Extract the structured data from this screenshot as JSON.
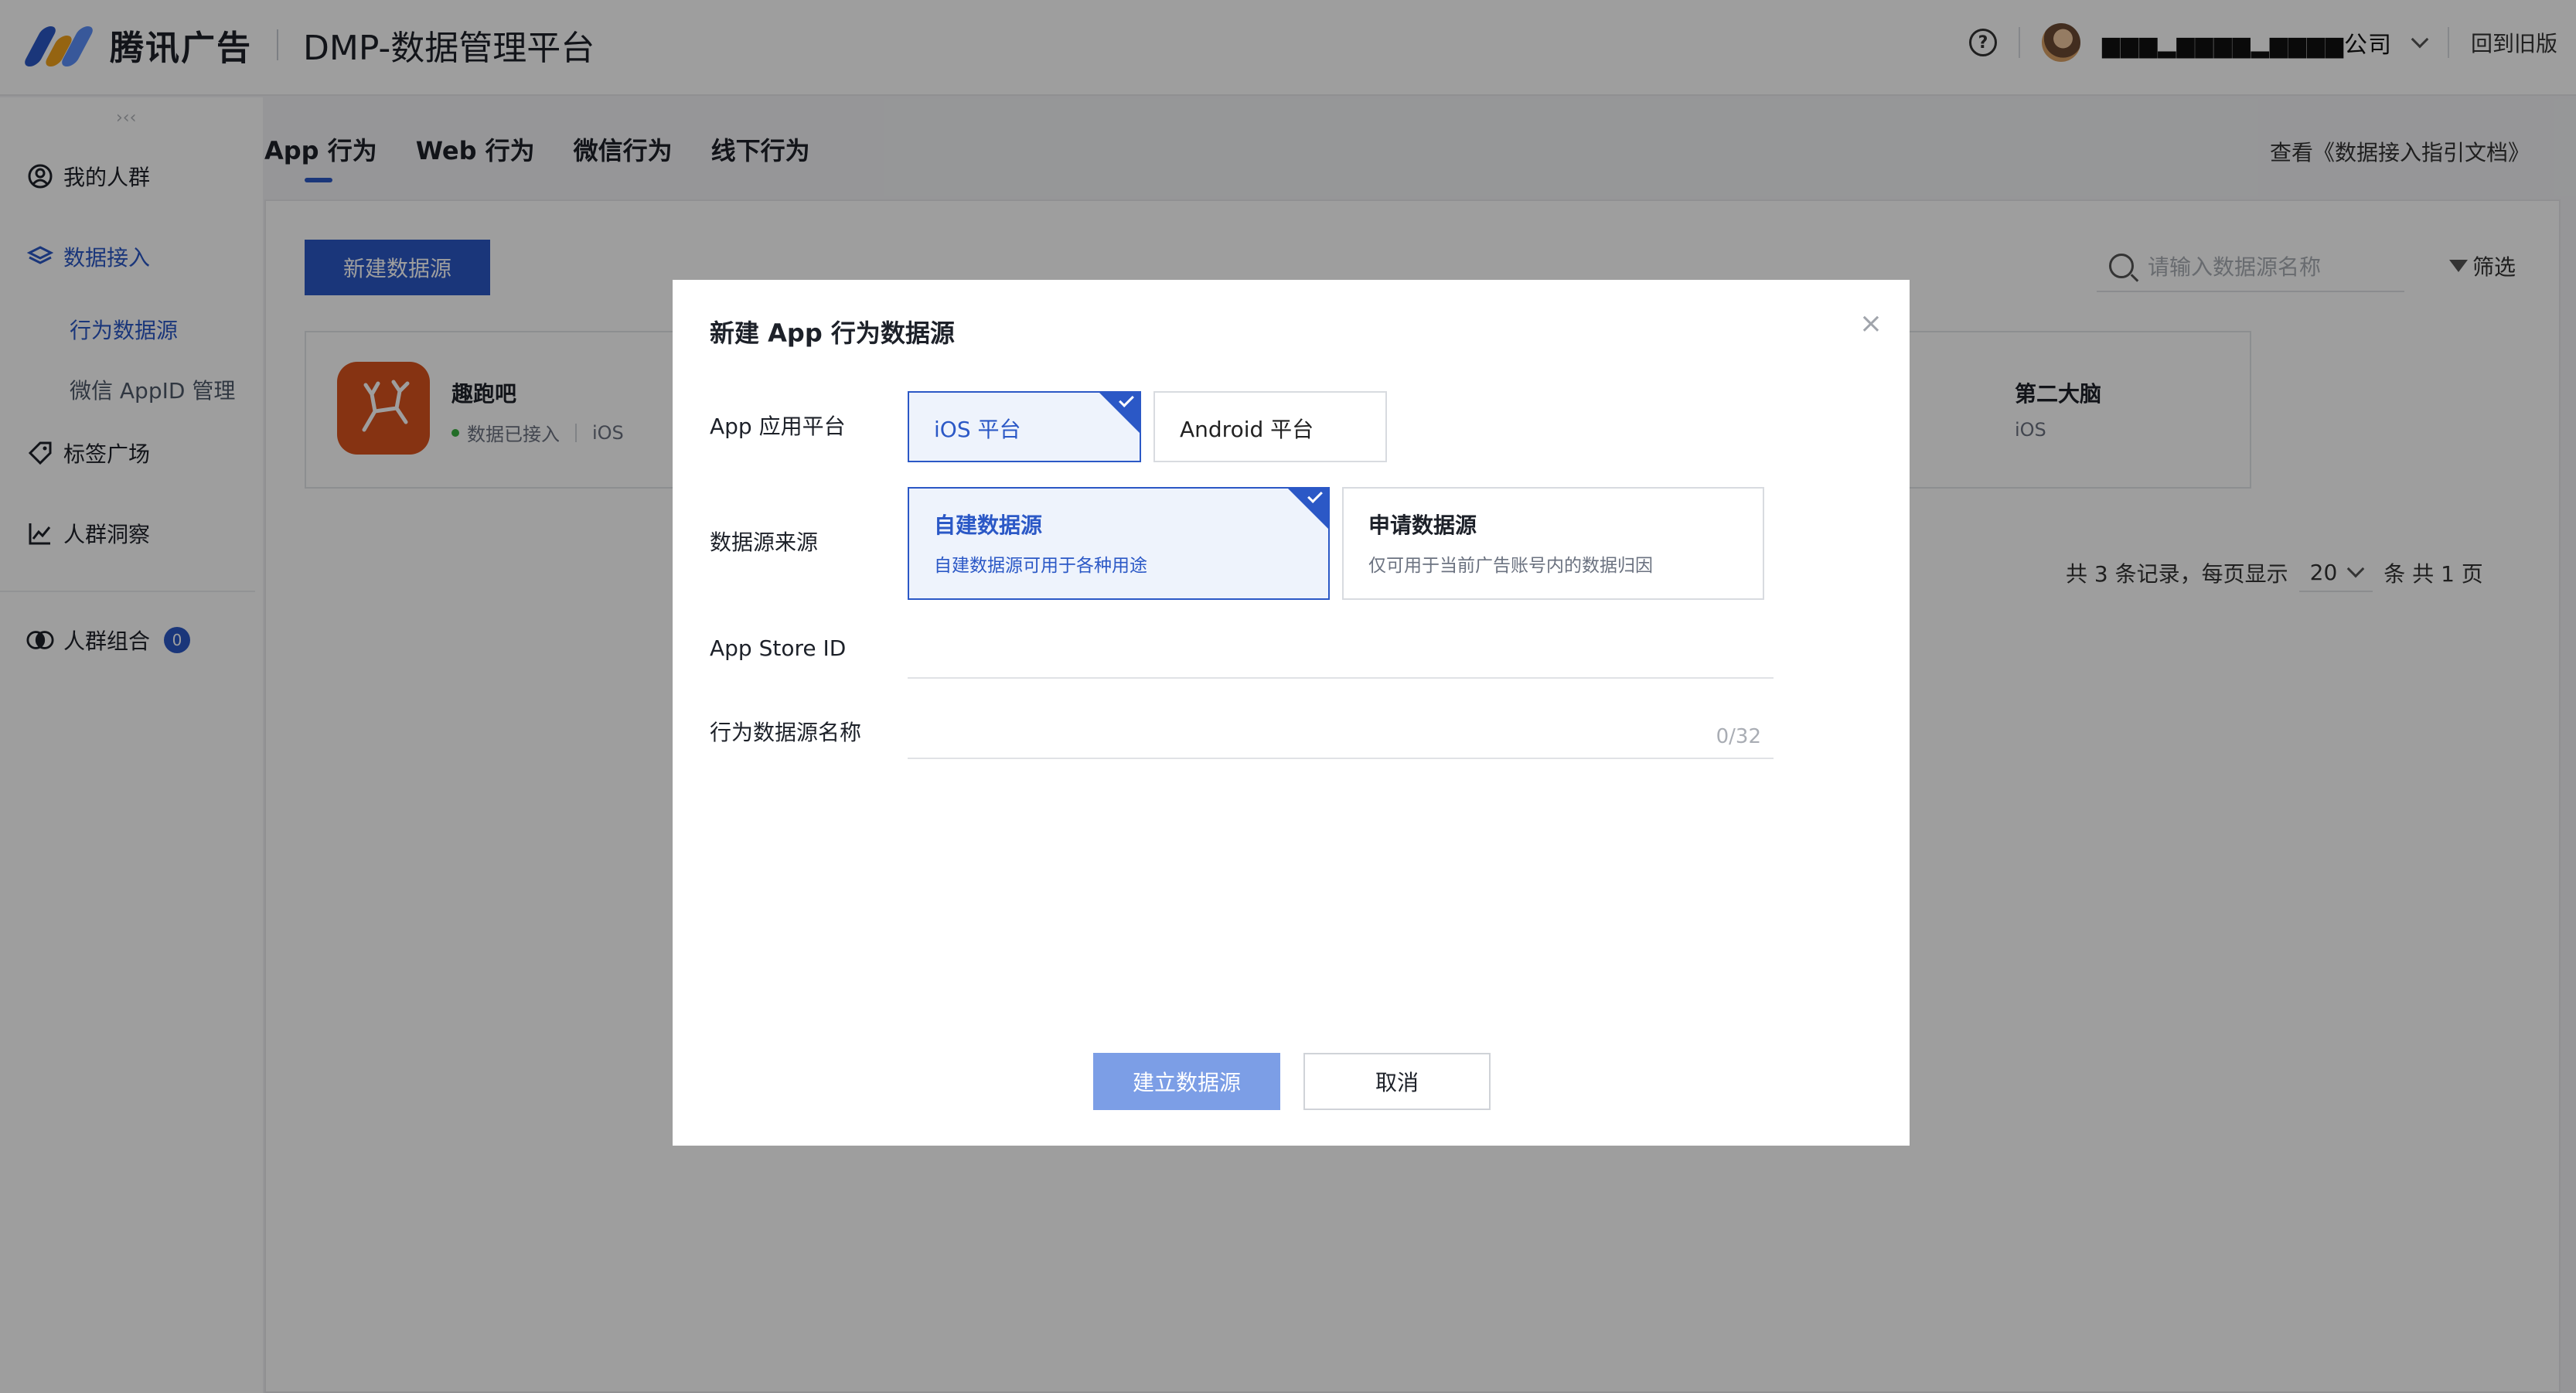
{
  "header": {
    "brand": "腾讯广告",
    "platform": "DMP-数据管理平台",
    "help_icon": "question-circle-icon",
    "account_name": "▆▆▆▂▆▆▆▆▂▆▆▆▆公司",
    "back_to_old": "回到旧版",
    "brand_colors": [
      "#2b58c6",
      "#f0a21c",
      "#5b8ff9"
    ]
  },
  "sidebar": {
    "collapse_glyph": "›‹‹",
    "items": [
      {
        "label": "我的人群",
        "icon": "user-circle-icon"
      },
      {
        "label": "数据接入",
        "icon": "layers-icon",
        "active": true
      },
      {
        "label": "标签广场",
        "icon": "tag-icon"
      },
      {
        "label": "人群洞察",
        "icon": "line-chart-icon"
      },
      {
        "label": "人群组合",
        "icon": "overlap-circles-icon",
        "badge": "0"
      }
    ],
    "subitems": [
      {
        "label": "行为数据源",
        "active": true
      },
      {
        "label": "微信 AppID 管理"
      }
    ]
  },
  "tabs": [
    {
      "label": "App 行为",
      "active": true
    },
    {
      "label": "Web 行为"
    },
    {
      "label": "微信行为"
    },
    {
      "label": "线下行为"
    }
  ],
  "doc_link": "查看《数据接入指引文档》",
  "toolbar": {
    "new_source": "新建数据源",
    "search_placeholder": "请输入数据源名称",
    "filter": "筛选"
  },
  "cards": [
    {
      "name": "趣跑吧",
      "status": "数据已接入",
      "platform": "iOS"
    },
    {
      "name": "第二大脑",
      "platform": "iOS"
    }
  ],
  "pagination": {
    "total": "共 3 条记录，每页显示",
    "page_size": "20",
    "pages": "条 共 1 页"
  },
  "modal": {
    "title": "新建 App 行为数据源",
    "close": "×",
    "platform_label": "App 应用平台",
    "platform_options": [
      {
        "label": "iOS 平台",
        "selected": true
      },
      {
        "label": "Android 平台",
        "selected": false
      }
    ],
    "source_label": "数据源来源",
    "source_options": [
      {
        "title": "自建数据源",
        "desc": "自建数据源可用于各种用途",
        "selected": true
      },
      {
        "title": "申请数据源",
        "desc": "仅可用于当前广告账号内的数据归因",
        "selected": false
      }
    ],
    "app_store_id_label": "App Store ID",
    "app_store_id_value": "",
    "name_label": "行为数据源名称",
    "name_value": "",
    "name_count": "0/32",
    "submit": "建立数据源",
    "cancel": "取消"
  }
}
